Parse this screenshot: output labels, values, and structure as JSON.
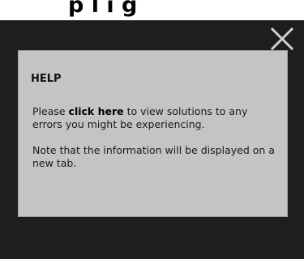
{
  "top_strip": {
    "text": "p l i g"
  },
  "help": {
    "title": "HELP",
    "paragraph1_before": "Please ",
    "link_text": "click here",
    "paragraph1_after": " to view solutions to any errors you might be experiencing.",
    "paragraph2": "Note that the information will be displayed on a new tab."
  },
  "icons": {
    "close": "close-icon"
  },
  "colors": {
    "modal_background": "#1e1e1e",
    "panel_background": "#c4c4c4",
    "close_icon": "#cfcfcf"
  }
}
